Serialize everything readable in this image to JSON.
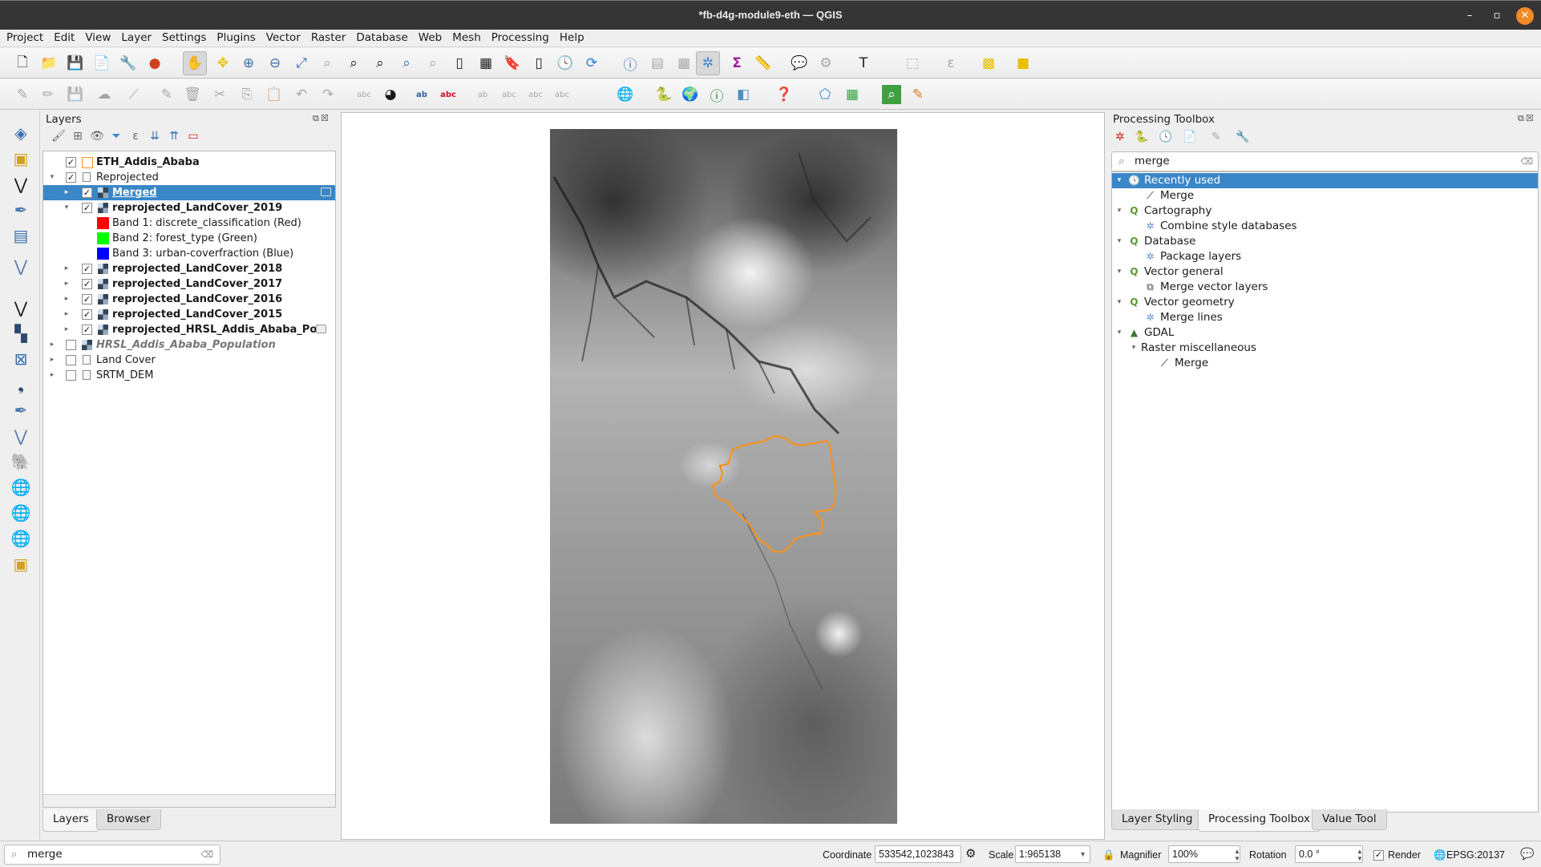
{
  "window": {
    "title": "*fb-d4g-module9-eth — QGIS",
    "minimize": "–",
    "maximize": "▫",
    "close": "✕"
  },
  "menu": [
    "Project",
    "Edit",
    "View",
    "Layer",
    "Settings",
    "Plugins",
    "Vector",
    "Raster",
    "Database",
    "Web",
    "Mesh",
    "Processing",
    "Help"
  ],
  "layers_panel": {
    "title": "Layers",
    "items": [
      {
        "name": "ETH_Addis_Ababa",
        "checked": true,
        "style": "bold",
        "type": "vector-polygon"
      },
      {
        "name": "Reprojected",
        "checked": true,
        "style": "normal",
        "type": "group",
        "expanded": true
      },
      {
        "name": "Merged",
        "checked": true,
        "style": "bold",
        "type": "raster",
        "selected": true
      },
      {
        "name": "reprojected_LandCover_2019",
        "checked": true,
        "style": "bold",
        "type": "raster",
        "expanded": true
      },
      {
        "name": "Band 1: discrete_classification (Red)",
        "type": "band",
        "color": "#ff0000"
      },
      {
        "name": "Band 2: forest_type (Green)",
        "type": "band",
        "color": "#00ff00"
      },
      {
        "name": "Band 3: urban-coverfraction (Blue)",
        "type": "band",
        "color": "#0000ff"
      },
      {
        "name": "reprojected_LandCover_2018",
        "checked": true,
        "style": "bold",
        "type": "raster"
      },
      {
        "name": "reprojected_LandCover_2017",
        "checked": true,
        "style": "bold",
        "type": "raster"
      },
      {
        "name": "reprojected_LandCover_2016",
        "checked": true,
        "style": "bold",
        "type": "raster"
      },
      {
        "name": "reprojected_LandCover_2015",
        "checked": true,
        "style": "bold",
        "type": "raster"
      },
      {
        "name": "reprojected_HRSL_Addis_Ababa_Po",
        "checked": true,
        "style": "bold",
        "type": "raster"
      },
      {
        "name": "HRSL_Addis_Ababa_Population",
        "checked": false,
        "style": "italic",
        "type": "raster"
      },
      {
        "name": "Land Cover",
        "checked": false,
        "style": "normal",
        "type": "group"
      },
      {
        "name": "SRTM_DEM",
        "checked": false,
        "style": "normal",
        "type": "group"
      }
    ],
    "tabs": [
      "Layers",
      "Browser"
    ],
    "active_tab": "Layers"
  },
  "locator": {
    "value": "merge"
  },
  "processing_toolbox": {
    "title": "Processing Toolbox",
    "search_value": "merge",
    "tree": [
      {
        "label": "Recently used",
        "level": 0,
        "icon": "clock",
        "selected": true
      },
      {
        "label": "Merge",
        "level": 1,
        "icon": "gdal-merge"
      },
      {
        "label": "Cartography",
        "level": 0,
        "icon": "qgis"
      },
      {
        "label": "Combine style databases",
        "level": 1,
        "icon": "gear"
      },
      {
        "label": "Database",
        "level": 0,
        "icon": "qgis"
      },
      {
        "label": "Package layers",
        "level": 1,
        "icon": "gear"
      },
      {
        "label": "Vector general",
        "level": 0,
        "icon": "qgis"
      },
      {
        "label": "Merge vector layers",
        "level": 1,
        "icon": "merge-vector"
      },
      {
        "label": "Vector geometry",
        "level": 0,
        "icon": "qgis"
      },
      {
        "label": "Merge lines",
        "level": 1,
        "icon": "gear"
      },
      {
        "label": "GDAL",
        "level": 0,
        "icon": "gdal"
      },
      {
        "label": "Raster miscellaneous",
        "level": 1,
        "icon": "none"
      },
      {
        "label": "Merge",
        "level": 2,
        "icon": "gdal-merge"
      }
    ],
    "tabs": [
      "Layer Styling",
      "Processing Toolbox",
      "Value Tool"
    ],
    "active_tab": "Processing Toolbox"
  },
  "statusbar": {
    "coordinate_label": "Coordinate",
    "coordinate_value": "533542,1023843",
    "scale_label": "Scale",
    "scale_value": "1:965138",
    "magnifier_label": "Magnifier",
    "magnifier_value": "100%",
    "rotation_label": "Rotation",
    "rotation_value": "0.0 °",
    "render_label": "Render",
    "render_checked": true,
    "crs": "EPSG:20137"
  },
  "colors": {
    "selection": "#3a87c8",
    "boundary": "#f7931e",
    "close_button": "#f08a24"
  }
}
